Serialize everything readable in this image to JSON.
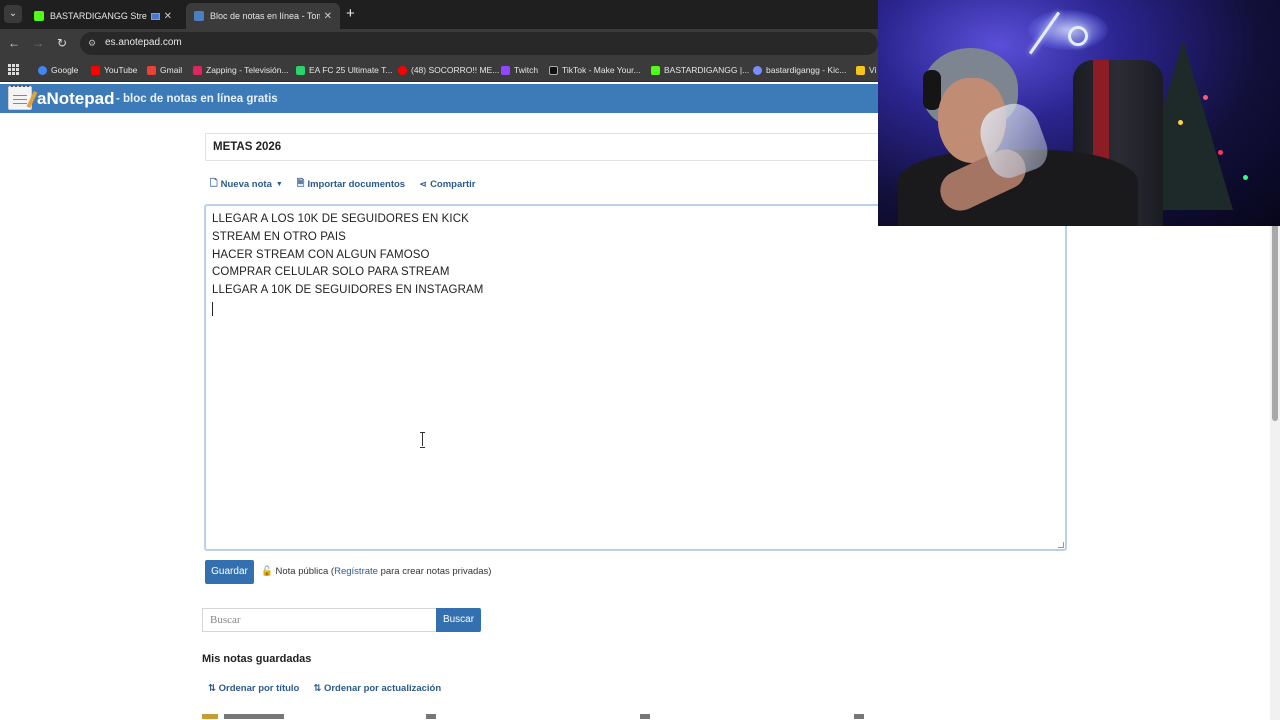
{
  "browser": {
    "tabs": [
      {
        "title": "BASTARDIGANGG Stream -",
        "favicon_color": "#53fc18"
      },
      {
        "title": "Bloc de notas en línea - Toma y",
        "favicon_color": "#4a7fc1"
      }
    ],
    "new_tab_glyph": "+",
    "close_glyph": "✕",
    "url": "es.anotepad.com",
    "bookmarks": [
      {
        "label": "Google",
        "color": "#4285f4"
      },
      {
        "label": "YouTube",
        "color": "#ff0000"
      },
      {
        "label": "Gmail",
        "color": "#ea4335"
      },
      {
        "label": "Zapping - Televisión...",
        "color": "#e0245e"
      },
      {
        "label": "EA FC 25 Ultimate T...",
        "color": "#2bd46a"
      },
      {
        "label": "(48) SOCORRO!! ME...",
        "color": "#ff0000"
      },
      {
        "label": "Twitch",
        "color": "#9146ff"
      },
      {
        "label": "TikTok - Make Your...",
        "color": "#111111"
      },
      {
        "label": "BASTARDIGANGG |...",
        "color": "#53fc18"
      },
      {
        "label": "bastardigangg - Kic...",
        "color": "#7a8cff"
      },
      {
        "label": "Vi",
        "color": "#f5c518"
      }
    ]
  },
  "site": {
    "brand": "aNotepad",
    "tagline": "- bloc de notas en línea gratis",
    "brand_color": "#3d7ab8"
  },
  "note": {
    "title": "METAS 2026",
    "actions": {
      "new_note": "Nueva nota",
      "import": "Importar documentos",
      "share": "Compartir"
    },
    "lines": [
      "LLEGAR A LOS 10K DE SEGUIDORES EN KICK",
      "STREAM EN OTRO PAIS",
      "HACER STREAM CON ALGUN FAMOSO",
      "COMPRAR CELULAR SOLO PARA STREAM",
      "LLEGAR A 10K DE SEGUIDORES EN INSTAGRAM"
    ],
    "save_label": "Guardar",
    "public_prefix": "Nota pública (",
    "register_link": "Regístrate",
    "public_suffix": " para crear notas privadas)"
  },
  "search": {
    "placeholder": "Buscar",
    "button": "Buscar"
  },
  "saved": {
    "title": "Mis notas guardadas",
    "sort_by_title": "Ordenar por título",
    "sort_by_update": "Ordenar por actualización"
  }
}
